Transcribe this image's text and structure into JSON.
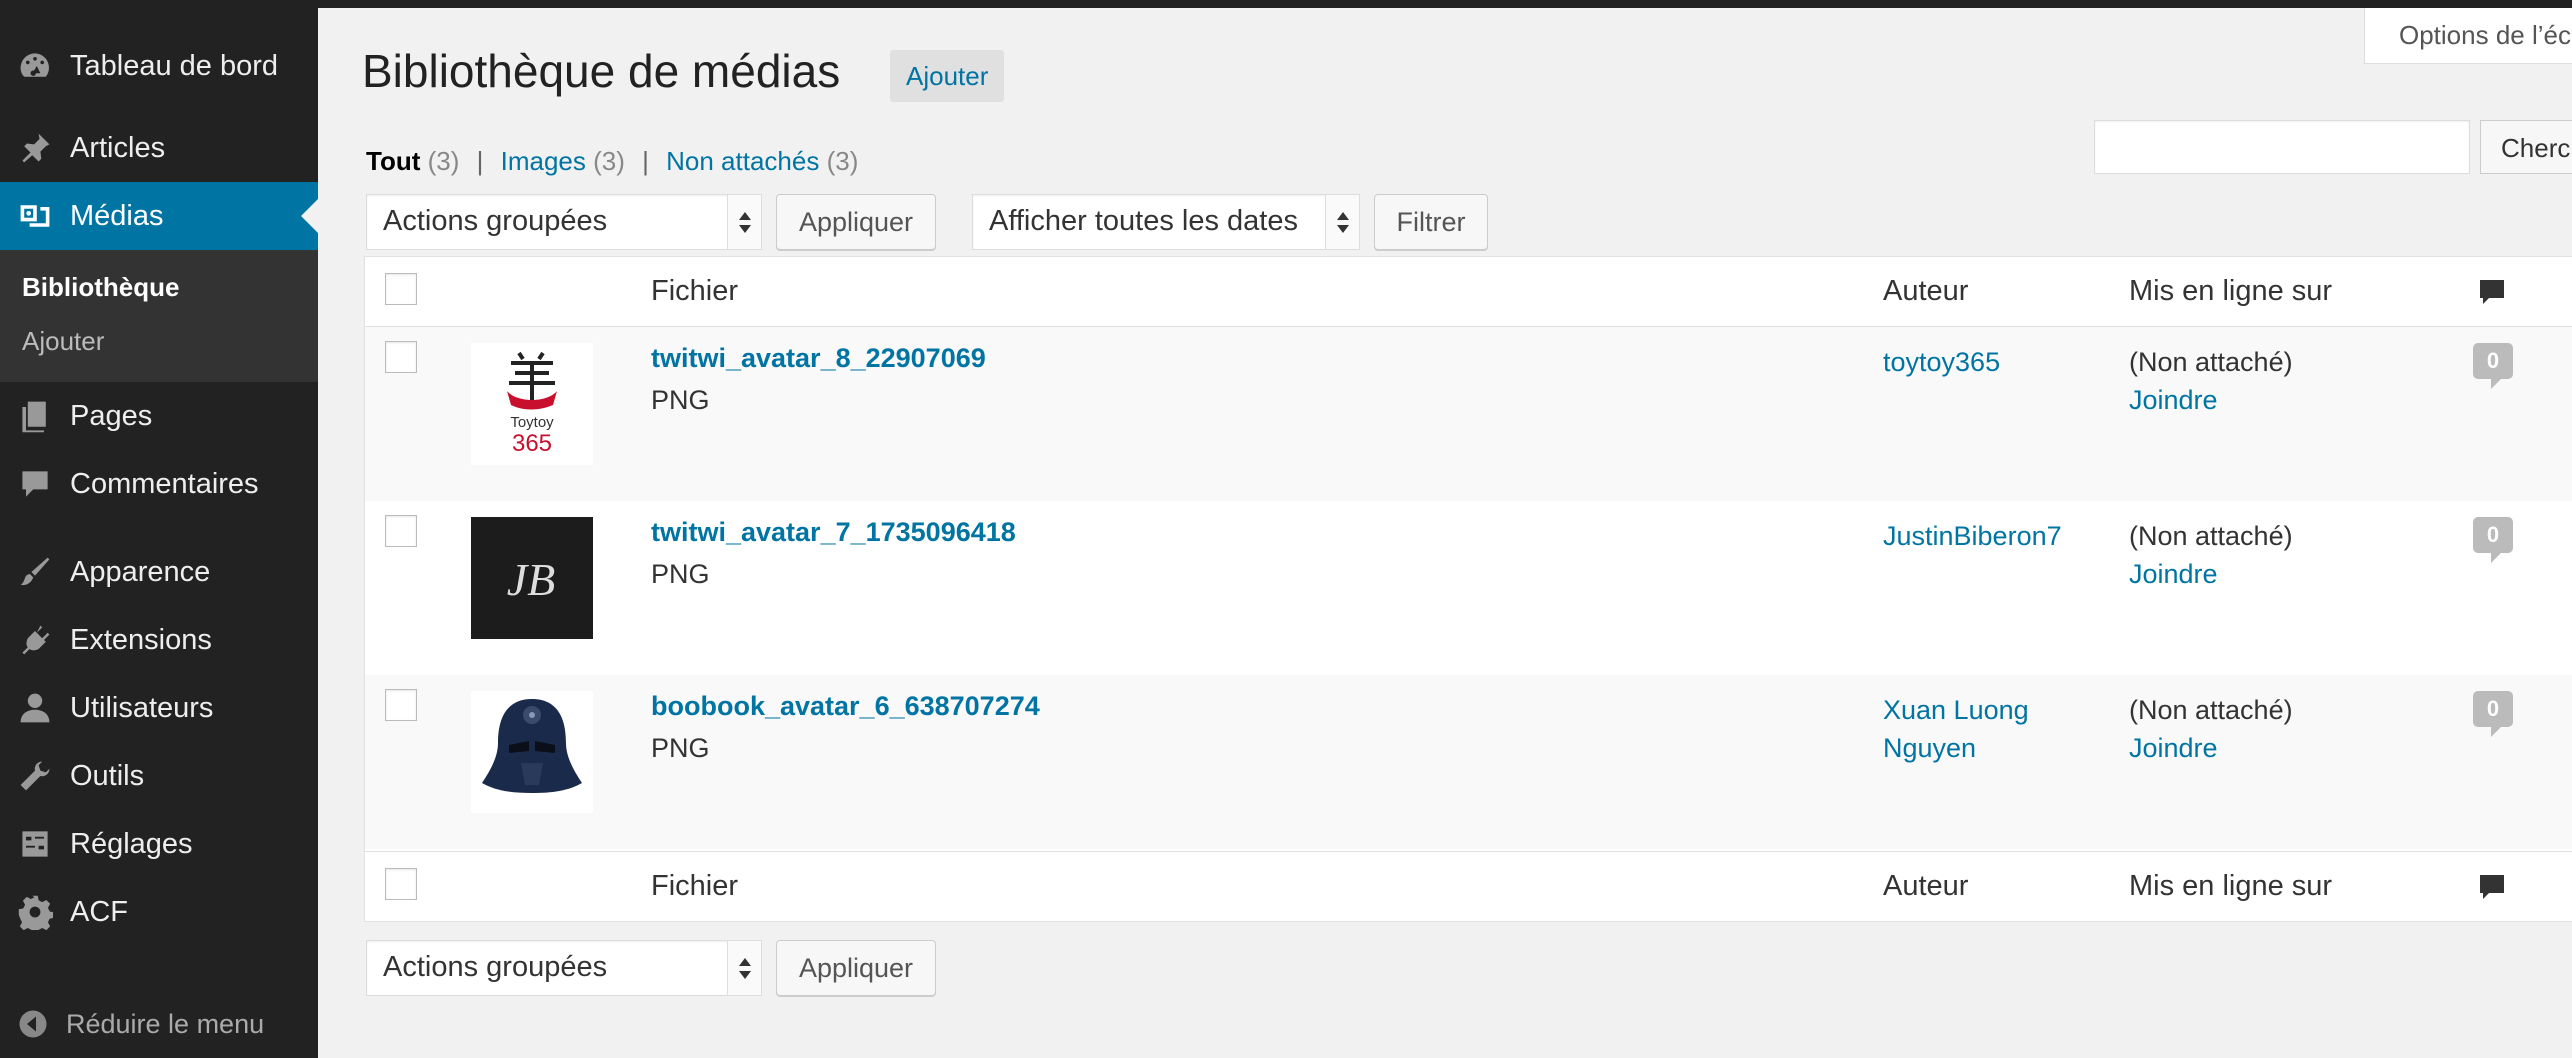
{
  "sidebar": {
    "items": [
      {
        "label": "Tableau de bord",
        "icon": "dashboard-icon"
      },
      {
        "label": "Articles",
        "icon": "pin-icon"
      },
      {
        "label": "Médias",
        "icon": "media-icon",
        "active": true
      },
      {
        "label": "Pages",
        "icon": "pages-icon"
      },
      {
        "label": "Commentaires",
        "icon": "comment-icon"
      },
      {
        "label": "Apparence",
        "icon": "brush-icon"
      },
      {
        "label": "Extensions",
        "icon": "plugin-icon"
      },
      {
        "label": "Utilisateurs",
        "icon": "user-icon"
      },
      {
        "label": "Outils",
        "icon": "wrench-icon"
      },
      {
        "label": "Réglages",
        "icon": "settings-icon"
      },
      {
        "label": "ACF",
        "icon": "gear-icon"
      }
    ],
    "submenu": [
      {
        "label": "Bibliothèque",
        "current": true
      },
      {
        "label": "Ajouter"
      }
    ],
    "collapse_label": "Réduire le menu"
  },
  "screen_options": "Options de l’éc",
  "page": {
    "title": "Bibliothèque de médias",
    "add_new": "Ajouter"
  },
  "filters": {
    "all_label": "Tout",
    "all_count": "(3)",
    "images_label": "Images",
    "images_count": "(3)",
    "unattached_label": "Non attachés",
    "unattached_count": "(3)",
    "separator": "|"
  },
  "search": {
    "value": "",
    "button": "Cherc"
  },
  "bulk_actions": {
    "selected": "Actions groupées",
    "apply": "Appliquer"
  },
  "date_filter": {
    "selected": "Afficher toutes les dates",
    "button": "Filtrer"
  },
  "table": {
    "columns": {
      "file": "Fichier",
      "author": "Auteur",
      "uploaded_to": "Mis en ligne sur"
    },
    "rows": [
      {
        "file": "twitwi_avatar_8_22907069",
        "type": "PNG",
        "author": "toytoy365",
        "attached": "(Non attaché)",
        "join": "Joindre",
        "comments": "0"
      },
      {
        "file": "twitwi_avatar_7_1735096418",
        "type": "PNG",
        "author": "JustinBiberon7",
        "attached": "(Non attaché)",
        "join": "Joindre",
        "comments": "0"
      },
      {
        "file": "boobook_avatar_6_638707274",
        "type": "PNG",
        "author": "Xuan Luong Nguyen",
        "attached": "(Non attaché)",
        "join": "Joindre",
        "comments": "0"
      }
    ]
  },
  "thumbs": {
    "toytoy_text1": "Toytoy",
    "toytoy_text2": "365",
    "jb_text": "JB"
  },
  "colors": {
    "accent": "#0074a2",
    "sidebar": "#222222",
    "background": "#f1f1f1"
  }
}
